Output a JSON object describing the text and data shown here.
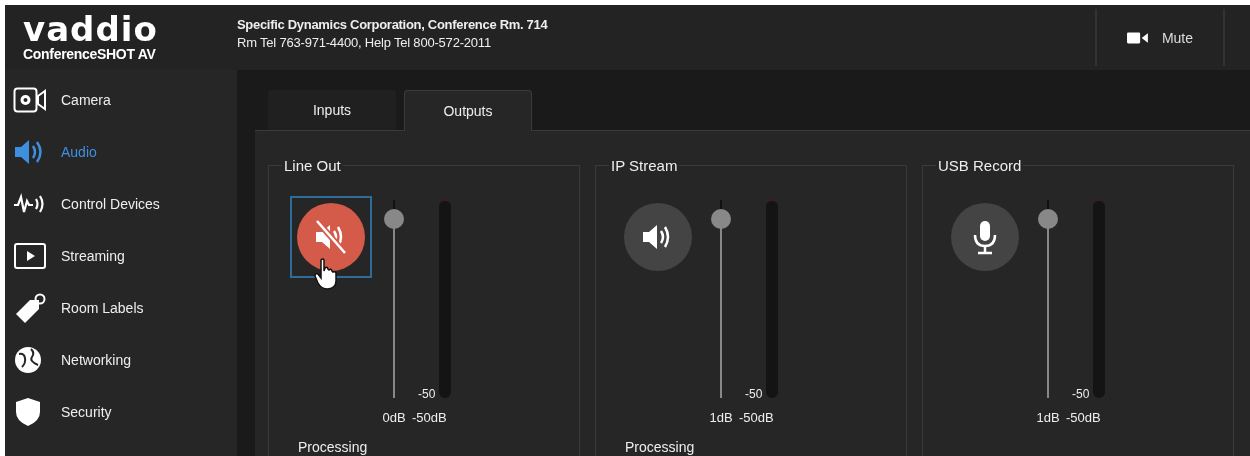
{
  "header": {
    "logo": "vaddio",
    "product": "ConferenceSHOT AV",
    "room_name": "Specific Dynamics Corporation, Conference Rm. 714",
    "room_phone": "Rm Tel 763-971-4400, Help Tel 800-572-2011",
    "mute_button": {
      "label": "Mute"
    }
  },
  "sidebar": {
    "items": [
      {
        "label": "Camera",
        "kind": "camera",
        "selected": false
      },
      {
        "label": "Audio",
        "kind": "audio",
        "selected": true
      },
      {
        "label": "Control Devices",
        "kind": "control",
        "selected": false
      },
      {
        "label": "Streaming",
        "kind": "streaming",
        "selected": false
      },
      {
        "label": "Room Labels",
        "kind": "tag",
        "selected": false
      },
      {
        "label": "Networking",
        "kind": "globe",
        "selected": false
      },
      {
        "label": "Security",
        "kind": "shield",
        "selected": false
      }
    ]
  },
  "tabs": [
    {
      "label": "Inputs",
      "selected": false
    },
    {
      "label": "Outputs",
      "selected": true
    }
  ],
  "channels": [
    {
      "name": "Line Out",
      "kind": "speaker",
      "muted": true,
      "focused": true,
      "hovered": true,
      "slider": {
        "level": 0.95,
        "reading": "0dB"
      },
      "meter": {
        "level": 0,
        "scale_label": "-50",
        "reading": "-50dB"
      },
      "section": "Processing"
    },
    {
      "name": "IP Stream",
      "kind": "speaker",
      "muted": false,
      "focused": false,
      "hovered": false,
      "slider": {
        "level": 0.95,
        "reading": "1dB"
      },
      "meter": {
        "level": 0,
        "scale_label": "-50",
        "reading": "-50dB"
      },
      "section": "Processing"
    },
    {
      "name": "USB Record",
      "kind": "microphone",
      "muted": false,
      "focused": false,
      "hovered": false,
      "slider": {
        "level": 0.95,
        "reading": "1dB"
      },
      "meter": {
        "level": 0,
        "scale_label": "-50",
        "reading": "-50dB"
      }
    }
  ]
}
